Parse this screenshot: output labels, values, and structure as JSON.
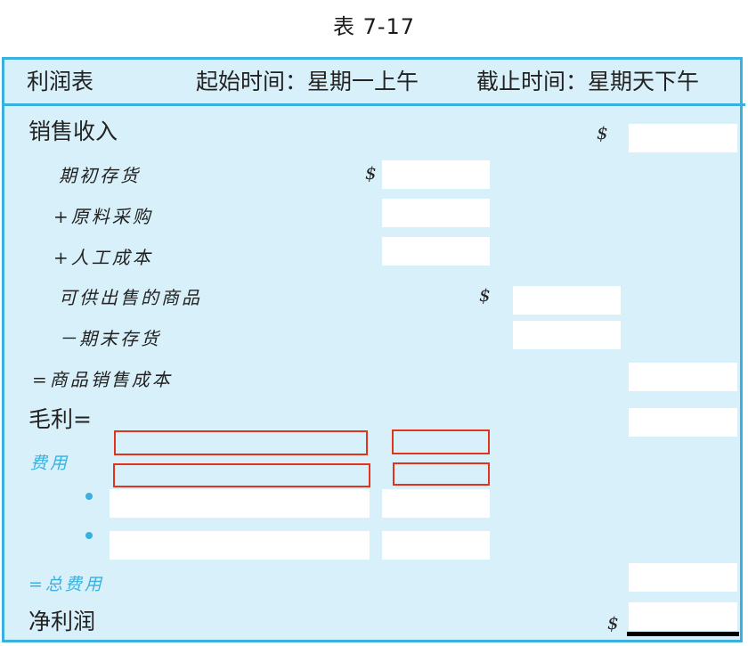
{
  "caption": "表 7-17",
  "header": {
    "title": "利润表",
    "start": "起始时间：星期一上午",
    "end": "截止时间：星期天下午"
  },
  "rows": {
    "sales_revenue": "销售收入",
    "beginning_inventory": "期初存货",
    "raw_material_purchase": "+原料采购",
    "labor_cost": "+人工成本",
    "goods_available": "可供出售的商品",
    "ending_inventory": "－期末存货",
    "cogs": "=商品销售成本",
    "gross_profit": "毛利=",
    "expenses": "费用",
    "total_expenses": "=总费用",
    "net_profit": "净利润"
  },
  "currency_symbol": "$",
  "colors": {
    "frame": "#39b0df",
    "panel": "#d8f0fa",
    "highlight_box": "#e2341d",
    "bullet": "#39b0df"
  }
}
